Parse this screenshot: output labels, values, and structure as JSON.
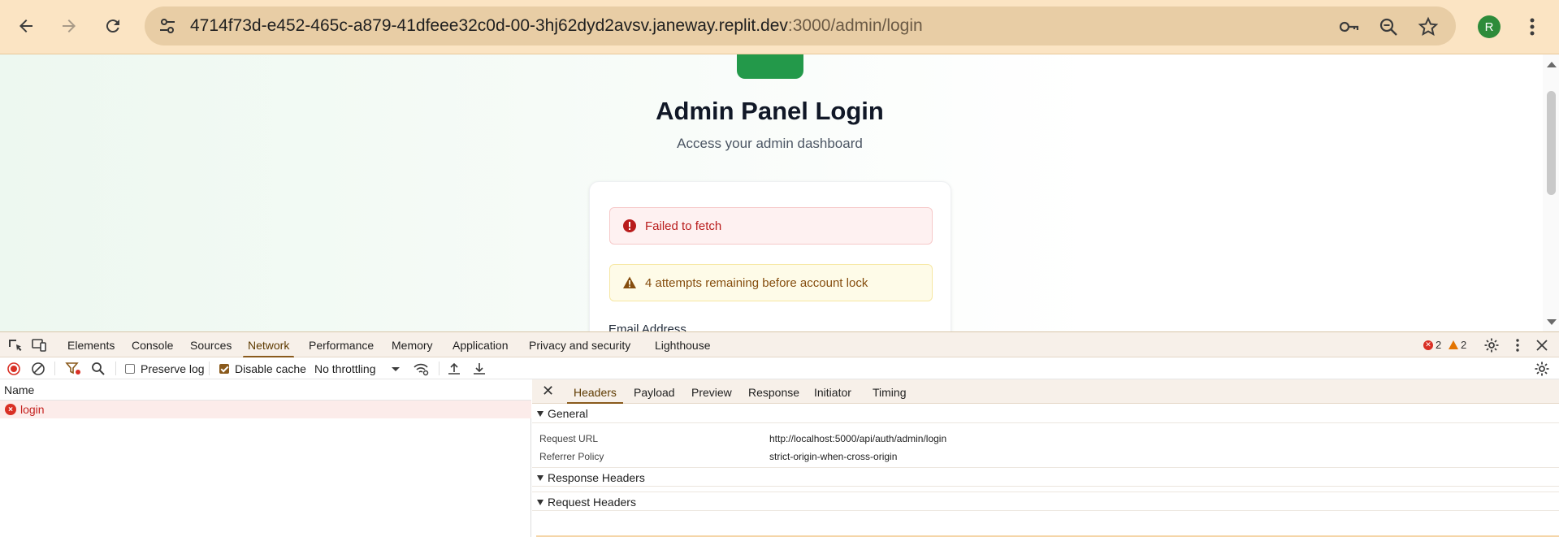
{
  "browser": {
    "url_main": "4714f73d-e452-465c-a879-41dfeee32c0d-00-3hj62dyd2avsv.janeway.replit.dev",
    "url_path": ":3000/admin/login",
    "avatar_letter": "R"
  },
  "page": {
    "title": "Admin Panel Login",
    "subtitle": "Access your admin dashboard",
    "error_message": "Failed to fetch",
    "warning_message": "4 attempts remaining before account lock",
    "email_label": "Email Address"
  },
  "devtools": {
    "tabs": [
      "Elements",
      "Console",
      "Sources",
      "Network",
      "Performance",
      "Memory",
      "Application",
      "Privacy and security",
      "Lighthouse"
    ],
    "active_tab": "Network",
    "error_count": "2",
    "warning_count": "2",
    "toolbar": {
      "preserve_log": "Preserve log",
      "disable_cache": "Disable cache",
      "throttling": "No throttling"
    },
    "requests": {
      "column_name": "Name",
      "rows": [
        {
          "name": "login",
          "status": "failed"
        }
      ]
    },
    "detail": {
      "tabs": [
        "Headers",
        "Payload",
        "Preview",
        "Response",
        "Initiator",
        "Timing"
      ],
      "active_tab": "Headers",
      "general_label": "General",
      "request_url_key": "Request URL",
      "request_url_value": "http://localhost:5000/api/auth/admin/login",
      "referrer_key": "Referrer Policy",
      "referrer_value": "strict-origin-when-cross-origin",
      "response_headers_label": "Response Headers",
      "request_headers_label": "Request Headers"
    }
  },
  "colors": {
    "chrome_bg": "#fbe4c3",
    "accent_green": "#23994a",
    "error_red": "#b91c1c",
    "warning_brown": "#854d0e",
    "devtools_accent": "#8a5a1c"
  }
}
